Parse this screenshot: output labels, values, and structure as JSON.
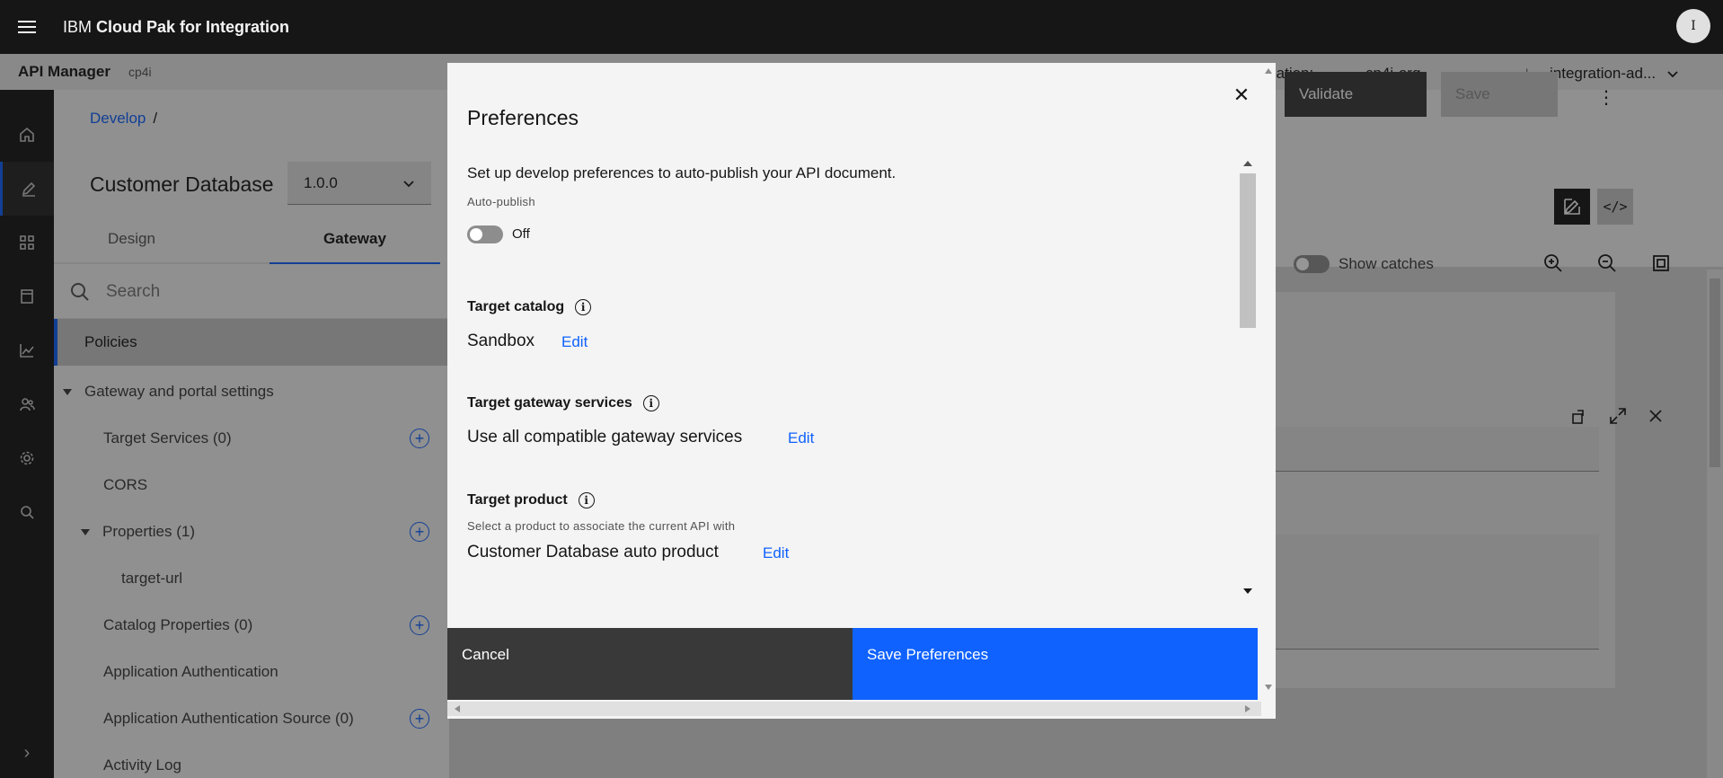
{
  "header": {
    "brand_prefix": "IBM",
    "brand_name": "Cloud Pak for Integration",
    "avatar_initial": "I"
  },
  "subheader": {
    "app_name": "API Manager",
    "app_tag": "cp4i",
    "org_label": "ganization:",
    "org_value": "cp4i-org",
    "separator": "|",
    "user": "integration-ad..."
  },
  "nav_rail": {
    "items": [
      {
        "icon": "home-icon"
      },
      {
        "icon": "edit-icon",
        "active": true
      },
      {
        "icon": "apps-icon"
      },
      {
        "icon": "catalog-icon"
      },
      {
        "icon": "analytics-icon"
      },
      {
        "icon": "members-icon"
      },
      {
        "icon": "settings-icon"
      },
      {
        "icon": "search-icon"
      }
    ],
    "expand_glyph": "›"
  },
  "page": {
    "breadcrumb_link": "Develop",
    "breadcrumb_sep": "/",
    "title": "Customer Database",
    "version": "1.0.0",
    "tabs": [
      "Design",
      "Gateway"
    ],
    "active_tab": "Gateway",
    "search_placeholder": "Search",
    "policies_label": "Policies",
    "tree": {
      "section_label": "Gateway and portal settings",
      "items": [
        {
          "label": "Target Services (0)",
          "add": true
        },
        {
          "label": "CORS",
          "add": false
        },
        {
          "label": "Properties (1)",
          "add": true,
          "expanded": true
        },
        {
          "label": "target-url",
          "add": false
        },
        {
          "label": "Catalog Properties (0)",
          "add": true
        },
        {
          "label": "Application Authentication",
          "add": false
        },
        {
          "label": "Application Authentication Source (0)",
          "add": true
        },
        {
          "label": "Activity Log",
          "add": false
        }
      ]
    },
    "validate_label": "Validate",
    "save_label": "Save",
    "kebab_glyph": "⋮",
    "code_glyph": "</>",
    "show_catches_label": "Show catches"
  },
  "modal": {
    "title": "Preferences",
    "close_glyph": "✕",
    "intro": "Set up develop preferences to auto-publish your API document.",
    "auto_publish_label": "Auto-publish",
    "auto_publish_state": "Off",
    "target_catalog": {
      "title": "Target catalog",
      "value": "Sandbox",
      "edit": "Edit"
    },
    "target_gateway": {
      "title": "Target gateway services",
      "value": "Use all compatible gateway services",
      "edit": "Edit"
    },
    "target_product": {
      "title": "Target product",
      "help": "Select a product to associate the current API with",
      "value": "Customer Database auto product",
      "edit": "Edit"
    },
    "info_glyph": "i",
    "cancel_label": "Cancel",
    "save_label": "Save Preferences"
  },
  "colors": {
    "brand_blue": "#0f62fe",
    "header_bg": "#161616",
    "modal_bg": "#f4f4f4"
  }
}
